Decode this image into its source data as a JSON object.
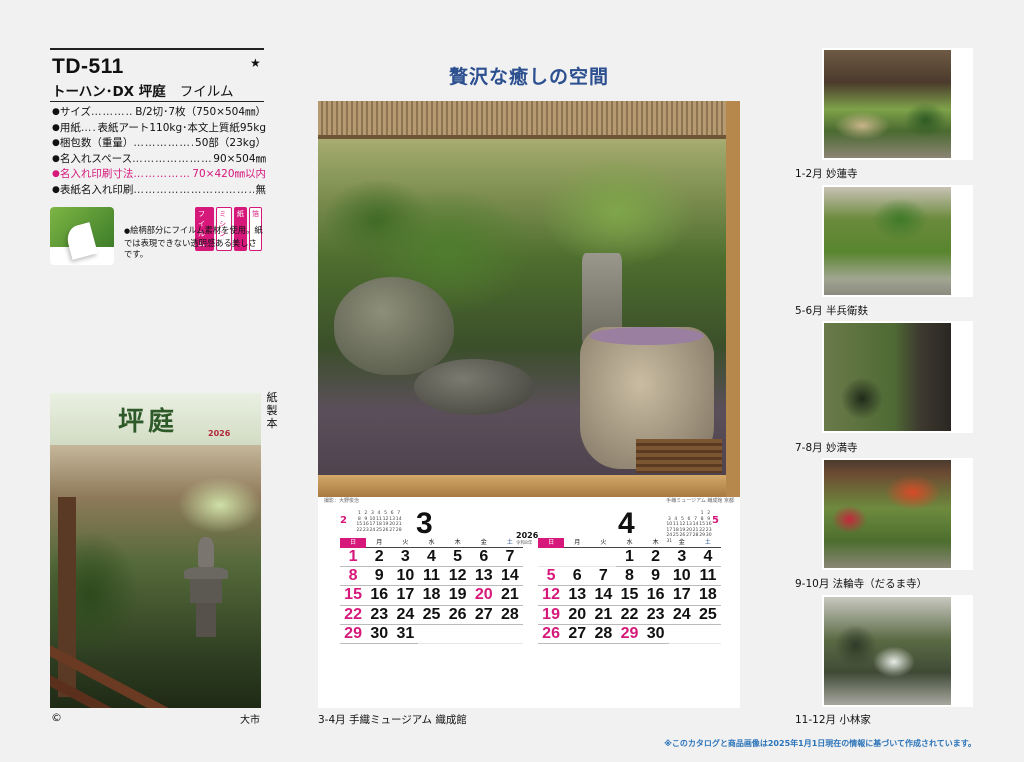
{
  "product": {
    "code": "TD-511",
    "star": "★",
    "name": "トーハン･DX 坪庭",
    "type": "フイルム"
  },
  "specs": [
    {
      "key": "サイズ",
      "value": "B/2切･7枚（750×504㎜）",
      "highlight": false
    },
    {
      "key": "用紙",
      "value": "表紙アート110kg･本文上質紙95kg",
      "highlight": false
    },
    {
      "key": "梱包数（重量）",
      "value": "50部（23kg）",
      "highlight": false
    },
    {
      "key": "名入れスペース",
      "value": "90×504㎜",
      "highlight": false
    },
    {
      "key": "名入れ印刷寸法",
      "value": "70×420㎜以内",
      "highlight": true
    },
    {
      "key": "表紙名入れ印刷",
      "value": "無",
      "highlight": false
    }
  ],
  "film": {
    "badges": [
      "フイルム",
      "ミシン",
      "紙",
      "箔"
    ],
    "description": "絵柄部分にフイルム素材を使用。紙では表現できない透明感ある美しさです。",
    "bullet": "●"
  },
  "cover": {
    "title": "坪庭",
    "year": "2026",
    "side_label": "紙製本",
    "copyright": "©",
    "brand": "大市"
  },
  "main": {
    "title": "贅沢な癒しの空間",
    "caption": "3-4月 手織ミュージアム 織成館",
    "photo_caption_left": "撮影：大野俊治",
    "photo_caption_right": "手織ミュージアム 織成館 京都",
    "year": "2026",
    "rokuyo_label": "令和8年",
    "weekdays": [
      "日",
      "月",
      "火",
      "水",
      "木",
      "金",
      "土"
    ],
    "months": [
      {
        "number": "3",
        "days": [
          "1",
          "2",
          "3",
          "4",
          "5",
          "6",
          "7",
          "8",
          "9",
          "10",
          "11",
          "12",
          "13",
          "14",
          "15",
          "16",
          "17",
          "18",
          "19",
          "20",
          "21",
          "22",
          "23",
          "24",
          "25",
          "26",
          "27",
          "28",
          "29",
          "30",
          "31",
          "",
          "",
          "",
          ""
        ],
        "red": [
          "1",
          "8",
          "15",
          "20",
          "22",
          "29"
        ]
      },
      {
        "number": "4",
        "days": [
          "",
          "",
          "",
          "1",
          "2",
          "3",
          "4",
          "5",
          "6",
          "7",
          "8",
          "9",
          "10",
          "11",
          "12",
          "13",
          "14",
          "15",
          "16",
          "17",
          "18",
          "19",
          "20",
          "21",
          "22",
          "23",
          "24",
          "25",
          "26",
          "27",
          "28",
          "29",
          "30",
          "",
          ""
        ],
        "red": [
          "5",
          "12",
          "19",
          "26",
          "29"
        ]
      }
    ],
    "mini_prev": {
      "number": "2",
      "days": [
        "1",
        "2",
        "3",
        "4",
        "5",
        "6",
        "7",
        "8",
        "9",
        "10",
        "11",
        "12",
        "13",
        "14",
        "15",
        "16",
        "17",
        "18",
        "19",
        "20",
        "21",
        "22",
        "23",
        "24",
        "25",
        "26",
        "27",
        "28"
      ]
    },
    "mini_next": {
      "number": "5",
      "days": [
        "",
        "",
        "",
        "",
        "",
        "1",
        "2",
        "3",
        "4",
        "5",
        "6",
        "7",
        "8",
        "9",
        "10",
        "11",
        "12",
        "13",
        "14",
        "15",
        "16",
        "17",
        "18",
        "19",
        "20",
        "21",
        "22",
        "23",
        "24",
        "25",
        "26",
        "27",
        "28",
        "29",
        "30",
        "31"
      ]
    }
  },
  "thumbnails": [
    {
      "caption": "1-2月 妙蓮寺"
    },
    {
      "caption": "5-6月 半兵衛麸"
    },
    {
      "caption": "7-8月 妙満寺"
    },
    {
      "caption": "9-10月 法輪寺（だるま寺）"
    },
    {
      "caption": "11-12月 小林家"
    }
  ],
  "footer_note": "※このカタログと商品画像は2025年1月1日現在の情報に基づいて作成されています。",
  "colors": {
    "accent_pink": "#d6187b",
    "title_blue": "#2b4f8f",
    "note_blue": "#2a73b8"
  }
}
